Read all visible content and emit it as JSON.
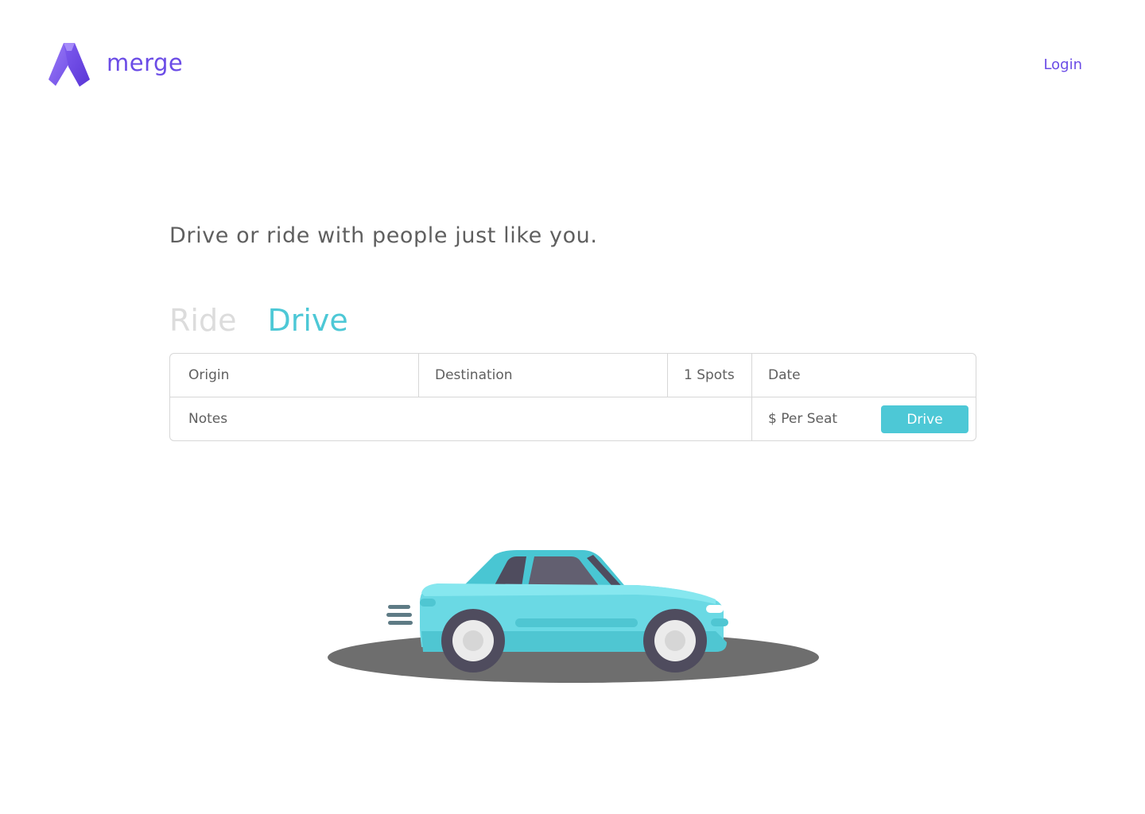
{
  "header": {
    "brand": "merge",
    "login_label": "Login"
  },
  "hero": {
    "tagline": "Drive or ride with people just like you.",
    "tabs": [
      {
        "label": "Ride",
        "active": false
      },
      {
        "label": "Drive",
        "active": true
      }
    ]
  },
  "form": {
    "origin_placeholder": "Origin",
    "destination_placeholder": "Destination",
    "spots_value": "1 Spots",
    "date_placeholder": "Date",
    "notes_placeholder": "Notes",
    "price_placeholder": "$ Per Seat",
    "submit_label": "Drive"
  },
  "colors": {
    "brand_purple": "#6b4ce6",
    "accent_teal": "#4dc8d6",
    "text_gray": "#5f5f5f",
    "inactive_tab": "#dcdcdc",
    "border": "#d7d7d7"
  },
  "icons": {
    "logo": "merge-logo-icon",
    "illustration": "car-illustration"
  }
}
